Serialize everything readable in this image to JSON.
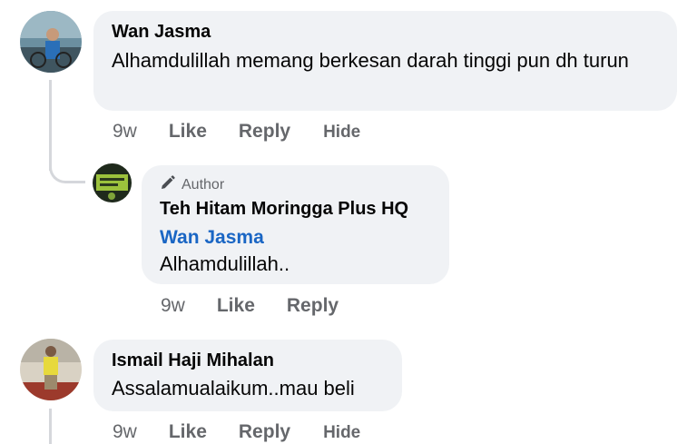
{
  "comments": [
    {
      "author": "Wan Jasma",
      "text": "Alhamdulillah memang berkesan darah tinggi pun dh turun",
      "time": "9w",
      "like": "Like",
      "reply": "Reply",
      "hide": "Hide"
    },
    {
      "badge": "Author",
      "author": "Teh Hitam Moringga Plus HQ",
      "mention": "Wan Jasma",
      "text": "Alhamdulillah..",
      "time": "9w",
      "like": "Like",
      "reply": "Reply"
    },
    {
      "author": "Ismail Haji Mihalan",
      "text": "Assalamualaikum..mau beli",
      "time": "9w",
      "like": "Like",
      "reply": "Reply",
      "hide": "Hide"
    }
  ],
  "colors": {
    "bubble": "#f0f2f5",
    "mention": "#1a66c4",
    "muted": "#65676b",
    "thread": "#d5d7db"
  },
  "icons": {
    "author_badge": "pencil-icon"
  }
}
